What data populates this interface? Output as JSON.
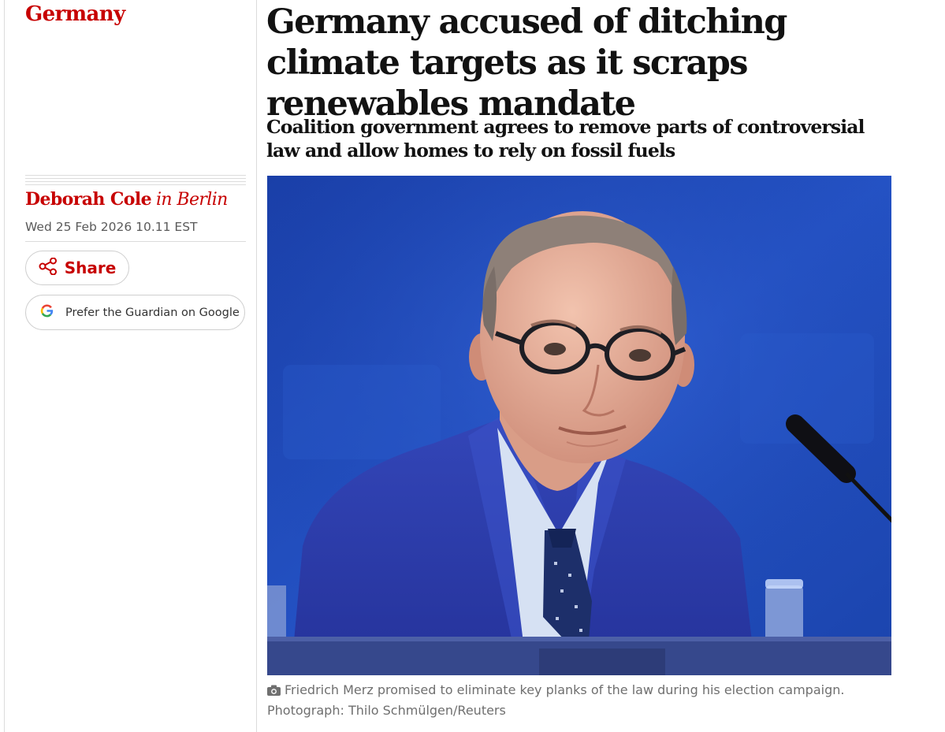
{
  "section": {
    "label": "Germany"
  },
  "byline": {
    "author": "Deborah Cole",
    "location": "in Berlin"
  },
  "dateline": "Wed 25 Feb 2026 10.11 EST",
  "actions": {
    "share_label": "Share",
    "google_label": "Prefer the Guardian on Google"
  },
  "article": {
    "headline": "Germany accused of ditching climate targets as it scraps renewables mandate",
    "standfirst": "Coalition government agrees to remove parts of controversial law and allow homes to rely on fossil fuels"
  },
  "image": {
    "caption": "Friedrich Merz promised to eliminate key planks of the law during his election campaign.",
    "credit": "Photograph: Thilo Schmülgen/Reuters"
  },
  "colors": {
    "accent": "#c70000",
    "headline_text": "#121212",
    "meta_text": "#5a5a5a",
    "caption_text": "#6f6f6f",
    "divider": "#dcdcdc",
    "photo_background": "#1d47b3"
  },
  "icons": {
    "share": "share-icon",
    "google": "google-g-icon",
    "camera": "camera-icon"
  }
}
